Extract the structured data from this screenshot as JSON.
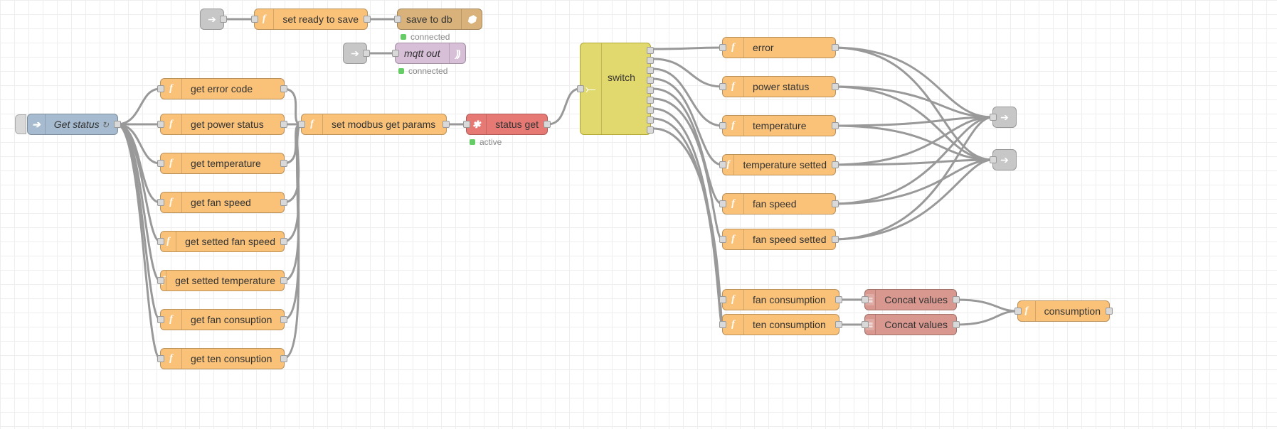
{
  "top": {
    "set_ready": "set ready to save",
    "save_db": "save to db",
    "mqtt_out": "mqtt out",
    "connected": "connected"
  },
  "inject": {
    "label": "Get status"
  },
  "left_funcs": [
    "get error code",
    "get power status",
    "get temperature",
    "get fan speed",
    "get setted fan speed",
    "get setted temperature",
    "get fan consuption",
    "get ten consuption"
  ],
  "set_modbus": "set modbus get params",
  "status_get": {
    "label": "status get",
    "status": "active"
  },
  "switch_label": "switch",
  "right_funcs": [
    "error",
    "power status",
    "temperature",
    "temperature setted",
    "fan speed",
    "fan speed setted"
  ],
  "consumption": {
    "fan": "fan consumption",
    "ten": "ten consumption",
    "concat": "Concat values",
    "out": "consumption"
  }
}
